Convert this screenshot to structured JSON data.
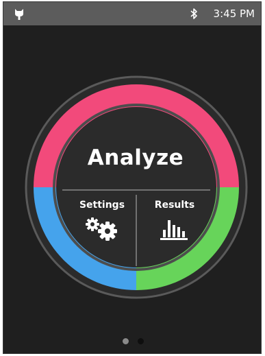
{
  "status_bar": {
    "time": "3:45 PM",
    "app_icon": "android-icon",
    "bluetooth_icon": "bluetooth-icon"
  },
  "dial": {
    "title": "Analyze",
    "settings_label": "Settings",
    "results_label": "Results",
    "settings_icon": "gears-icon",
    "results_icon": "bar-chart-icon",
    "ring_colors": {
      "top": "#f24a7b",
      "bottom_left": "#45a3ec",
      "bottom_right": "#67d45a"
    }
  },
  "pagination": {
    "page_count": 2,
    "current_page": 1
  }
}
